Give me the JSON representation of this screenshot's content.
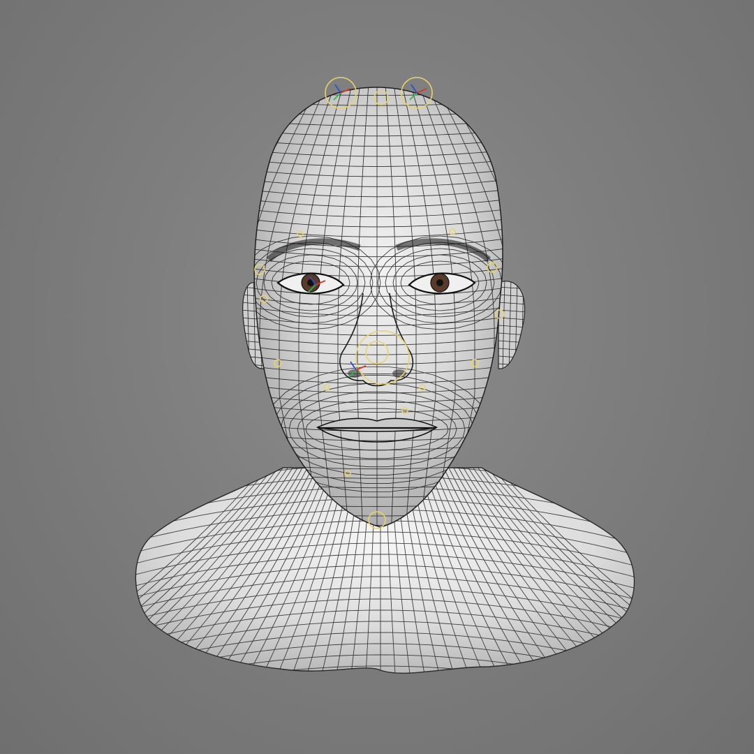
{
  "viewport": {
    "background_color": "#7f7f7f",
    "mesh_fill_color": "#e4e4e4",
    "wire_color": "#1c1c1c",
    "rig_handle_color": "#e8d36a",
    "axis_colors": {
      "x": "#d23a2a",
      "y": "#2fb34a",
      "z": "#2a4fd2"
    }
  },
  "model": {
    "object": "head-bust",
    "display_mode": "wireframe-on-shaded",
    "has_facial_rig_handles": true,
    "visible_parts": [
      "cranium",
      "ears",
      "eyebrows",
      "eyes",
      "nose",
      "lips",
      "chin",
      "neck",
      "shoulders"
    ]
  },
  "icons": {
    "rig_handle": "circle-control-icon",
    "axis_gizmo": "axis-gizmo-icon"
  }
}
